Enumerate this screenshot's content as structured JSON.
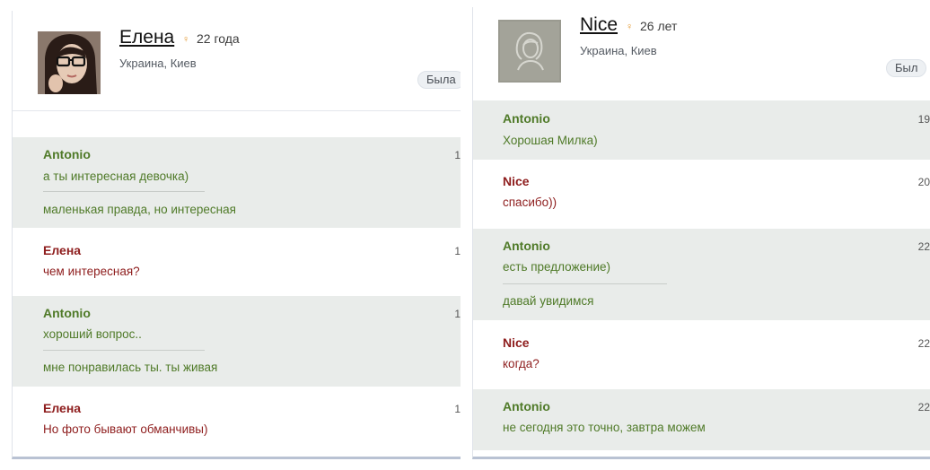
{
  "left_chat": {
    "profile": {
      "name": "Елена",
      "age_icon": "gender-female-icon",
      "age": "22 года",
      "location": "Украина, Киев",
      "status": "Была"
    },
    "messages": [
      {
        "sender": "Antonio",
        "time": "1",
        "lines": [
          "а ты интересная девочка)",
          "маленькая правда, но интересная"
        ]
      },
      {
        "sender": "Елена",
        "time": "1",
        "lines": [
          "чем интересная?"
        ]
      },
      {
        "sender": "Antonio",
        "time": "1",
        "lines": [
          "хороший вопрос..",
          "мне понравилась ты. ты живая"
        ]
      },
      {
        "sender": "Елена",
        "time": "1",
        "lines": [
          "Но фото бывают обманчивы)"
        ]
      }
    ]
  },
  "right_chat": {
    "profile": {
      "name": "Nice",
      "age_icon": "gender-female-icon",
      "age": "26 лет",
      "location": "Украина, Киев",
      "status": "Был"
    },
    "messages": [
      {
        "sender": "Antonio",
        "time": "19",
        "lines": [
          "Хорошая Милка)"
        ]
      },
      {
        "sender": "Nice",
        "time": "20",
        "lines": [
          "спасибо))"
        ]
      },
      {
        "sender": "Antonio",
        "time": "22",
        "lines": [
          "есть предложение)",
          "давай увидимся"
        ]
      },
      {
        "sender": "Nice",
        "time": "22",
        "lines": [
          "когда?"
        ]
      },
      {
        "sender": "Antonio",
        "time": "22",
        "lines": [
          "не сегодня это точно, завтра можем"
        ]
      }
    ]
  },
  "colors": {
    "antonio": "#4f7a28",
    "other": "#8e1d1d",
    "shaded_row": "#e9ecea"
  }
}
